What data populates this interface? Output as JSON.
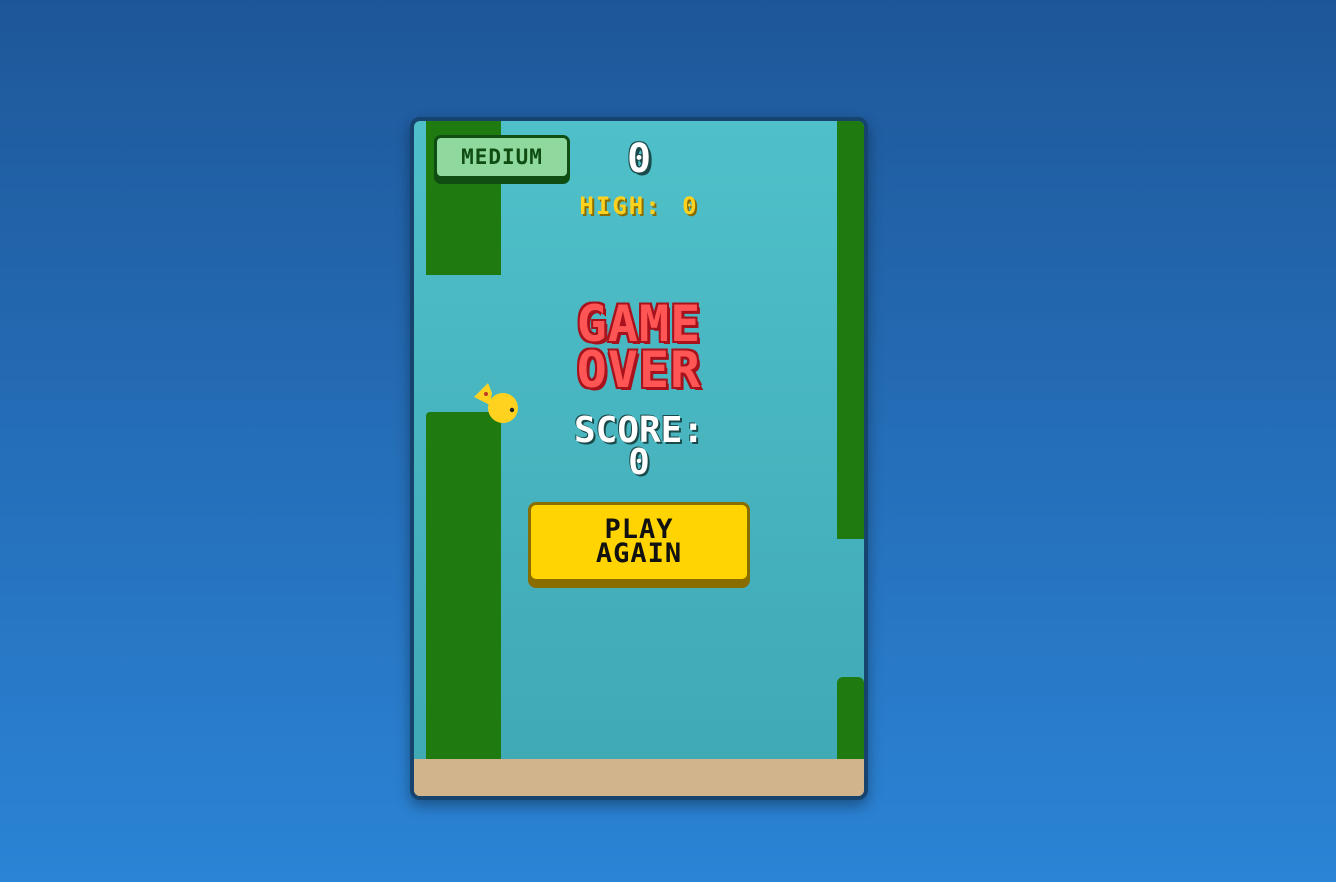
{
  "game": {
    "difficulty": "MEDIUM",
    "current_score": "0",
    "high_score_label": "HIGH:",
    "high_score_value": "0",
    "game_over_title": "GAME\nOVER",
    "final_score_label": "SCORE:",
    "final_score_value": "0",
    "play_again_label": "PLAY\nAGAIN"
  },
  "colors": {
    "background": "#2b84d6",
    "sky": "#4fc0c9",
    "pipe": "#1f7a0f",
    "ground": "#d2b48c",
    "bird": "#ffd21f",
    "game_over_text": "#ff5555",
    "button": "#ffd400",
    "badge": "#8fd89e"
  },
  "icons": {
    "player": "bird-icon"
  }
}
